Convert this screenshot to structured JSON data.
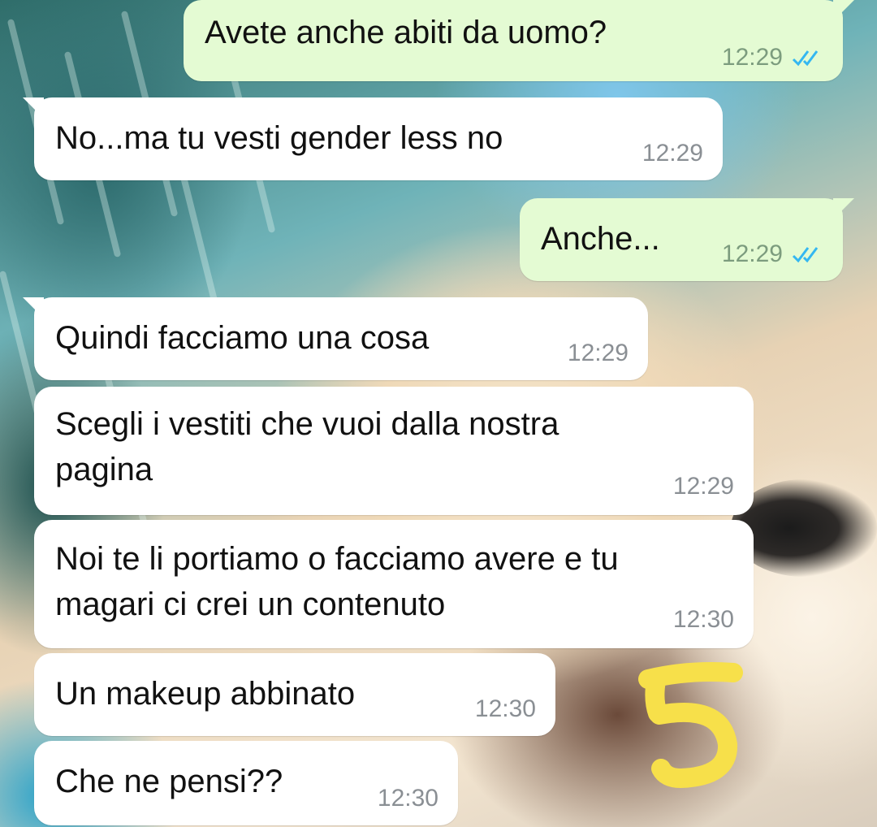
{
  "colors": {
    "incoming_bubble": "#ffffff",
    "outgoing_bubble": "#e4fbd3",
    "read_ticks": "#34b7f1",
    "doodle": "#f7e04a"
  },
  "messages": [
    {
      "direction": "outgoing",
      "text": "Avete anche abiti da uomo?",
      "time": "12:29",
      "status": "read"
    },
    {
      "direction": "incoming",
      "text": "No...ma tu vesti gender less no",
      "time": "12:29"
    },
    {
      "direction": "outgoing",
      "text": "Anche...",
      "time": "12:29",
      "status": "read"
    },
    {
      "direction": "incoming",
      "text": "Quindi facciamo una cosa",
      "time": "12:29"
    },
    {
      "direction": "incoming",
      "text": "Scegli i vestiti che vuoi dalla nostra\npagina",
      "time": "12:29"
    },
    {
      "direction": "incoming",
      "text": "Noi te li portiamo o facciamo avere e tu\nmagari ci crei un contenuto",
      "time": "12:30"
    },
    {
      "direction": "incoming",
      "text": "Un makeup abbinato",
      "time": "12:30"
    },
    {
      "direction": "incoming",
      "text": "Che ne pensi??",
      "time": "12:30"
    }
  ],
  "icons": {
    "read_receipt": "double-check-icon"
  }
}
